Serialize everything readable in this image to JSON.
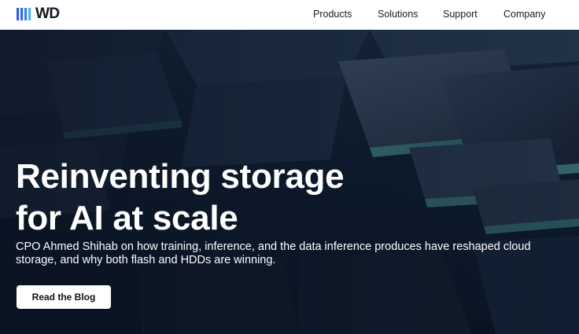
{
  "brand": {
    "logo_text": "WD",
    "logo_icon": "wd-stripes-icon",
    "logo_colors": [
      "#2f5fd6",
      "#3d7ee6",
      "#4fb3e8"
    ]
  },
  "nav": {
    "items": [
      {
        "label": "Products"
      },
      {
        "label": "Solutions"
      },
      {
        "label": "Support"
      },
      {
        "label": "Company"
      }
    ]
  },
  "hero": {
    "headline_line1": "Reinventing storage",
    "headline_line2": "for AI at scale",
    "subtext": "CPO Ahmed Shihab on how training, inference, and the data inference produces have reshaped cloud storage, and why both flash and HDDs are winning.",
    "cta_label": "Read the Blog",
    "background_image": "stacked-storage-slabs-image",
    "colors": {
      "background": "#0e1c2e",
      "accent_edge": "#4a8f90",
      "text": "#ffffff"
    }
  }
}
